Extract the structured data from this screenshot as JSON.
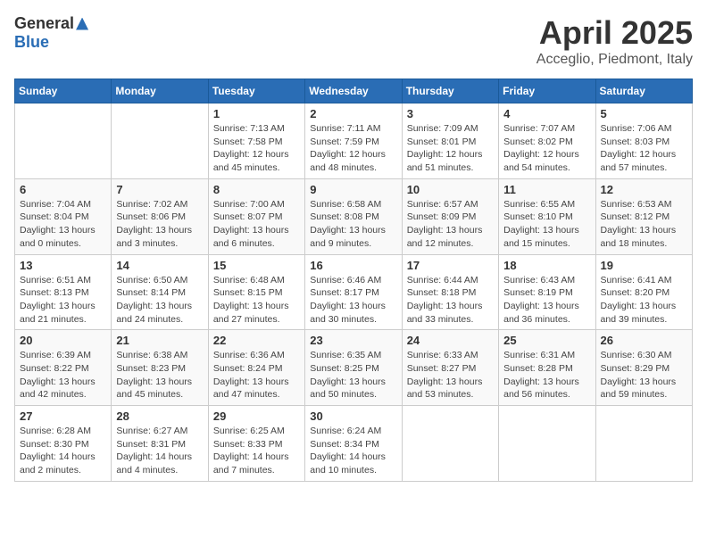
{
  "header": {
    "logo_general": "General",
    "logo_blue": "Blue",
    "title": "April 2025",
    "location": "Acceglio, Piedmont, Italy"
  },
  "calendar": {
    "days_of_week": [
      "Sunday",
      "Monday",
      "Tuesday",
      "Wednesday",
      "Thursday",
      "Friday",
      "Saturday"
    ],
    "weeks": [
      [
        {
          "day": "",
          "info": ""
        },
        {
          "day": "",
          "info": ""
        },
        {
          "day": "1",
          "info": "Sunrise: 7:13 AM\nSunset: 7:58 PM\nDaylight: 12 hours and 45 minutes."
        },
        {
          "day": "2",
          "info": "Sunrise: 7:11 AM\nSunset: 7:59 PM\nDaylight: 12 hours and 48 minutes."
        },
        {
          "day": "3",
          "info": "Sunrise: 7:09 AM\nSunset: 8:01 PM\nDaylight: 12 hours and 51 minutes."
        },
        {
          "day": "4",
          "info": "Sunrise: 7:07 AM\nSunset: 8:02 PM\nDaylight: 12 hours and 54 minutes."
        },
        {
          "day": "5",
          "info": "Sunrise: 7:06 AM\nSunset: 8:03 PM\nDaylight: 12 hours and 57 minutes."
        }
      ],
      [
        {
          "day": "6",
          "info": "Sunrise: 7:04 AM\nSunset: 8:04 PM\nDaylight: 13 hours and 0 minutes."
        },
        {
          "day": "7",
          "info": "Sunrise: 7:02 AM\nSunset: 8:06 PM\nDaylight: 13 hours and 3 minutes."
        },
        {
          "day": "8",
          "info": "Sunrise: 7:00 AM\nSunset: 8:07 PM\nDaylight: 13 hours and 6 minutes."
        },
        {
          "day": "9",
          "info": "Sunrise: 6:58 AM\nSunset: 8:08 PM\nDaylight: 13 hours and 9 minutes."
        },
        {
          "day": "10",
          "info": "Sunrise: 6:57 AM\nSunset: 8:09 PM\nDaylight: 13 hours and 12 minutes."
        },
        {
          "day": "11",
          "info": "Sunrise: 6:55 AM\nSunset: 8:10 PM\nDaylight: 13 hours and 15 minutes."
        },
        {
          "day": "12",
          "info": "Sunrise: 6:53 AM\nSunset: 8:12 PM\nDaylight: 13 hours and 18 minutes."
        }
      ],
      [
        {
          "day": "13",
          "info": "Sunrise: 6:51 AM\nSunset: 8:13 PM\nDaylight: 13 hours and 21 minutes."
        },
        {
          "day": "14",
          "info": "Sunrise: 6:50 AM\nSunset: 8:14 PM\nDaylight: 13 hours and 24 minutes."
        },
        {
          "day": "15",
          "info": "Sunrise: 6:48 AM\nSunset: 8:15 PM\nDaylight: 13 hours and 27 minutes."
        },
        {
          "day": "16",
          "info": "Sunrise: 6:46 AM\nSunset: 8:17 PM\nDaylight: 13 hours and 30 minutes."
        },
        {
          "day": "17",
          "info": "Sunrise: 6:44 AM\nSunset: 8:18 PM\nDaylight: 13 hours and 33 minutes."
        },
        {
          "day": "18",
          "info": "Sunrise: 6:43 AM\nSunset: 8:19 PM\nDaylight: 13 hours and 36 minutes."
        },
        {
          "day": "19",
          "info": "Sunrise: 6:41 AM\nSunset: 8:20 PM\nDaylight: 13 hours and 39 minutes."
        }
      ],
      [
        {
          "day": "20",
          "info": "Sunrise: 6:39 AM\nSunset: 8:22 PM\nDaylight: 13 hours and 42 minutes."
        },
        {
          "day": "21",
          "info": "Sunrise: 6:38 AM\nSunset: 8:23 PM\nDaylight: 13 hours and 45 minutes."
        },
        {
          "day": "22",
          "info": "Sunrise: 6:36 AM\nSunset: 8:24 PM\nDaylight: 13 hours and 47 minutes."
        },
        {
          "day": "23",
          "info": "Sunrise: 6:35 AM\nSunset: 8:25 PM\nDaylight: 13 hours and 50 minutes."
        },
        {
          "day": "24",
          "info": "Sunrise: 6:33 AM\nSunset: 8:27 PM\nDaylight: 13 hours and 53 minutes."
        },
        {
          "day": "25",
          "info": "Sunrise: 6:31 AM\nSunset: 8:28 PM\nDaylight: 13 hours and 56 minutes."
        },
        {
          "day": "26",
          "info": "Sunrise: 6:30 AM\nSunset: 8:29 PM\nDaylight: 13 hours and 59 minutes."
        }
      ],
      [
        {
          "day": "27",
          "info": "Sunrise: 6:28 AM\nSunset: 8:30 PM\nDaylight: 14 hours and 2 minutes."
        },
        {
          "day": "28",
          "info": "Sunrise: 6:27 AM\nSunset: 8:31 PM\nDaylight: 14 hours and 4 minutes."
        },
        {
          "day": "29",
          "info": "Sunrise: 6:25 AM\nSunset: 8:33 PM\nDaylight: 14 hours and 7 minutes."
        },
        {
          "day": "30",
          "info": "Sunrise: 6:24 AM\nSunset: 8:34 PM\nDaylight: 14 hours and 10 minutes."
        },
        {
          "day": "",
          "info": ""
        },
        {
          "day": "",
          "info": ""
        },
        {
          "day": "",
          "info": ""
        }
      ]
    ]
  }
}
